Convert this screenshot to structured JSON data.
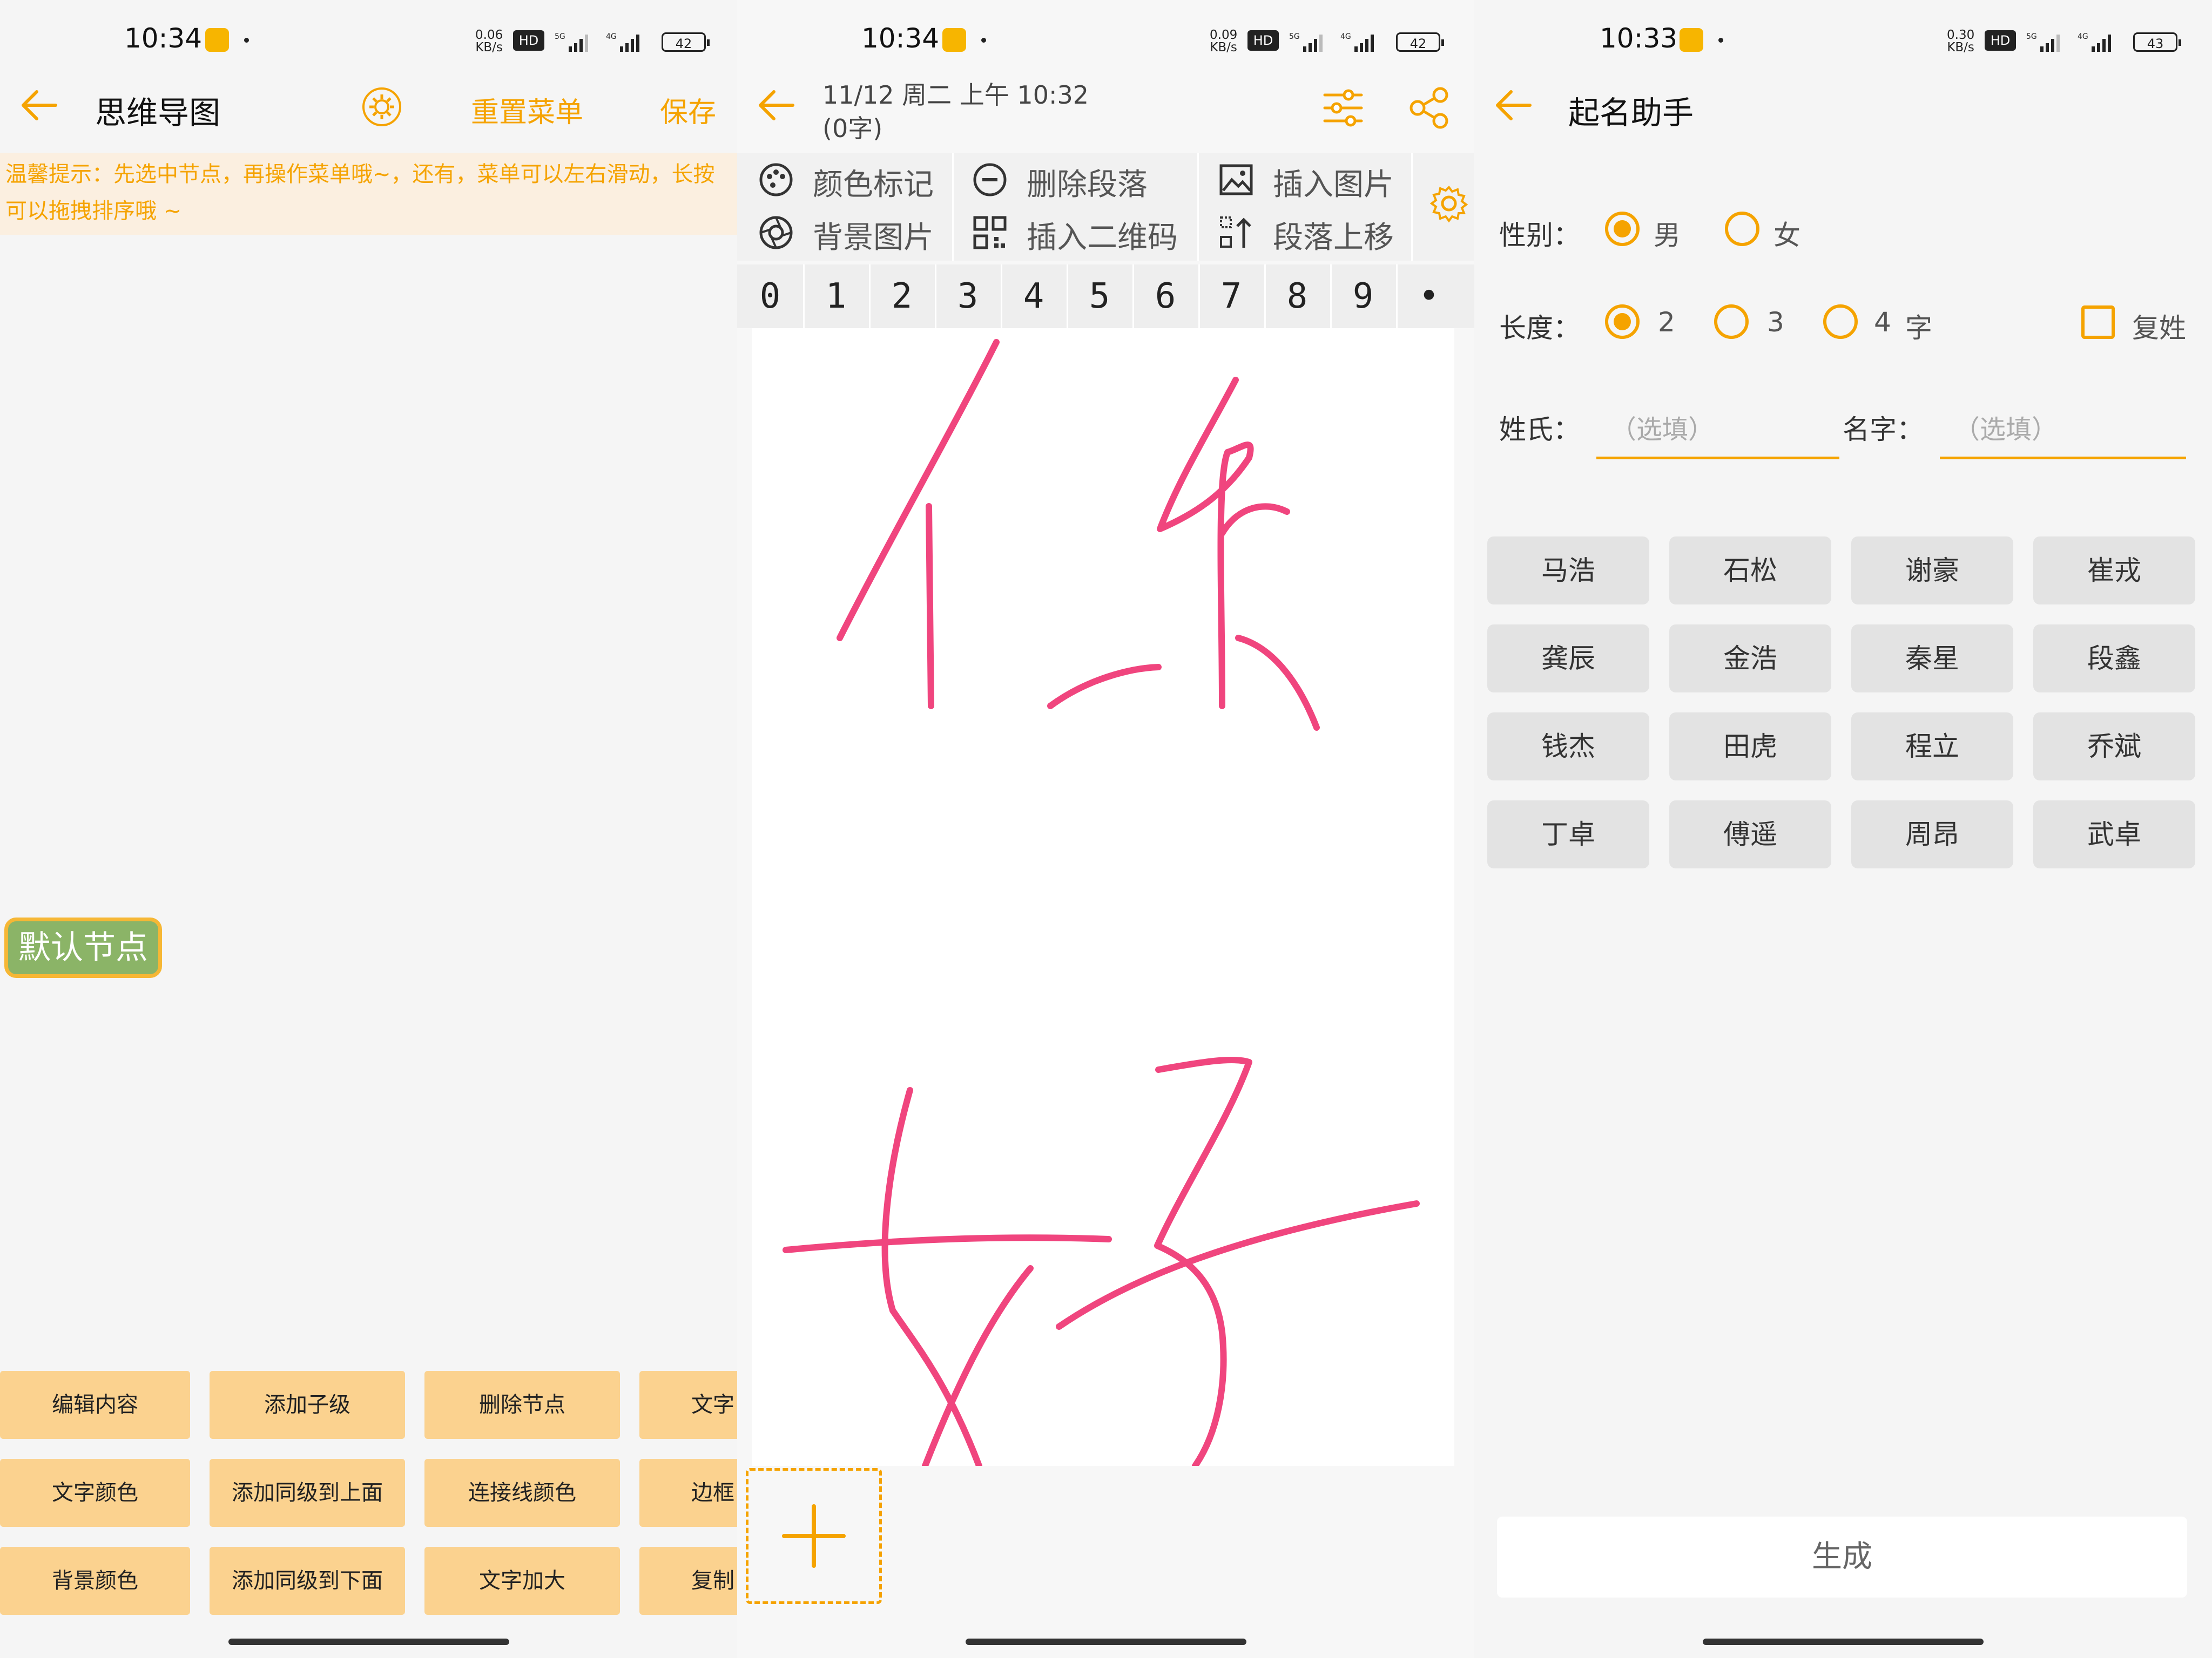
{
  "panel1": {
    "status": {
      "time": "10:34",
      "net_top": "0.06",
      "net_bottom": "KB/s",
      "hd": "HD",
      "s1": "5G",
      "s2": "4G",
      "battery": "42"
    },
    "title": "思维导图",
    "reset_label": "重置菜单",
    "save_label": "保存",
    "tip": "温馨提示：先选中节点，再操作菜单哦~，还有，菜单可以左右滑动，长按可以拖拽排序哦 ~",
    "node": "默认节点",
    "menu": [
      [
        "编辑内容",
        "添加子级",
        "删除节点",
        "文字"
      ],
      [
        "文字颜色",
        "添加同级到上面",
        "连接线颜色",
        "边框"
      ],
      [
        "背景颜色",
        "添加同级到下面",
        "文字加大",
        "复制"
      ]
    ]
  },
  "panel2": {
    "status": {
      "time": "10:34",
      "net_top": "0.09",
      "net_bottom": "KB/s",
      "hd": "HD",
      "s1": "5G",
      "s2": "4G",
      "battery": "42"
    },
    "date": "11/12 周二 上午 10:32",
    "count": "(0字)",
    "tools": {
      "color_mark": "颜色标记",
      "delete_para": "删除段落",
      "insert_image": "插入图片",
      "bg_image": "背景图片",
      "insert_qr": "插入二维码",
      "para_up": "段落上移"
    },
    "digits": [
      "0",
      "1",
      "2",
      "3",
      "4",
      "5",
      "6",
      "7",
      "8",
      "9",
      "•"
    ],
    "ink_color": "#f0457e"
  },
  "panel3": {
    "status": {
      "time": "10:33",
      "net_top": "0.30",
      "net_bottom": "KB/s",
      "hd": "HD",
      "s1": "5G",
      "s2": "4G",
      "battery": "43"
    },
    "title": "起名助手",
    "gender_label": "性别：",
    "male": "男",
    "female": "女",
    "length_label": "长度：",
    "len2": "2",
    "len3": "3",
    "len4": "4",
    "zi": "字",
    "compound_surname": "复姓",
    "surname_label": "姓氏：",
    "surname_placeholder": "（选填）",
    "given_label": "名字：",
    "given_placeholder": "（选填）",
    "names": [
      [
        "马浩",
        "石松",
        "谢豪",
        "崔戎"
      ],
      [
        "龚辰",
        "金浩",
        "秦星",
        "段鑫"
      ],
      [
        "钱杰",
        "田虎",
        "程立",
        "乔斌"
      ],
      [
        "丁卓",
        "傅遥",
        "周昂",
        "武卓"
      ]
    ],
    "generate": "生成",
    "accent": "#f5a300"
  }
}
